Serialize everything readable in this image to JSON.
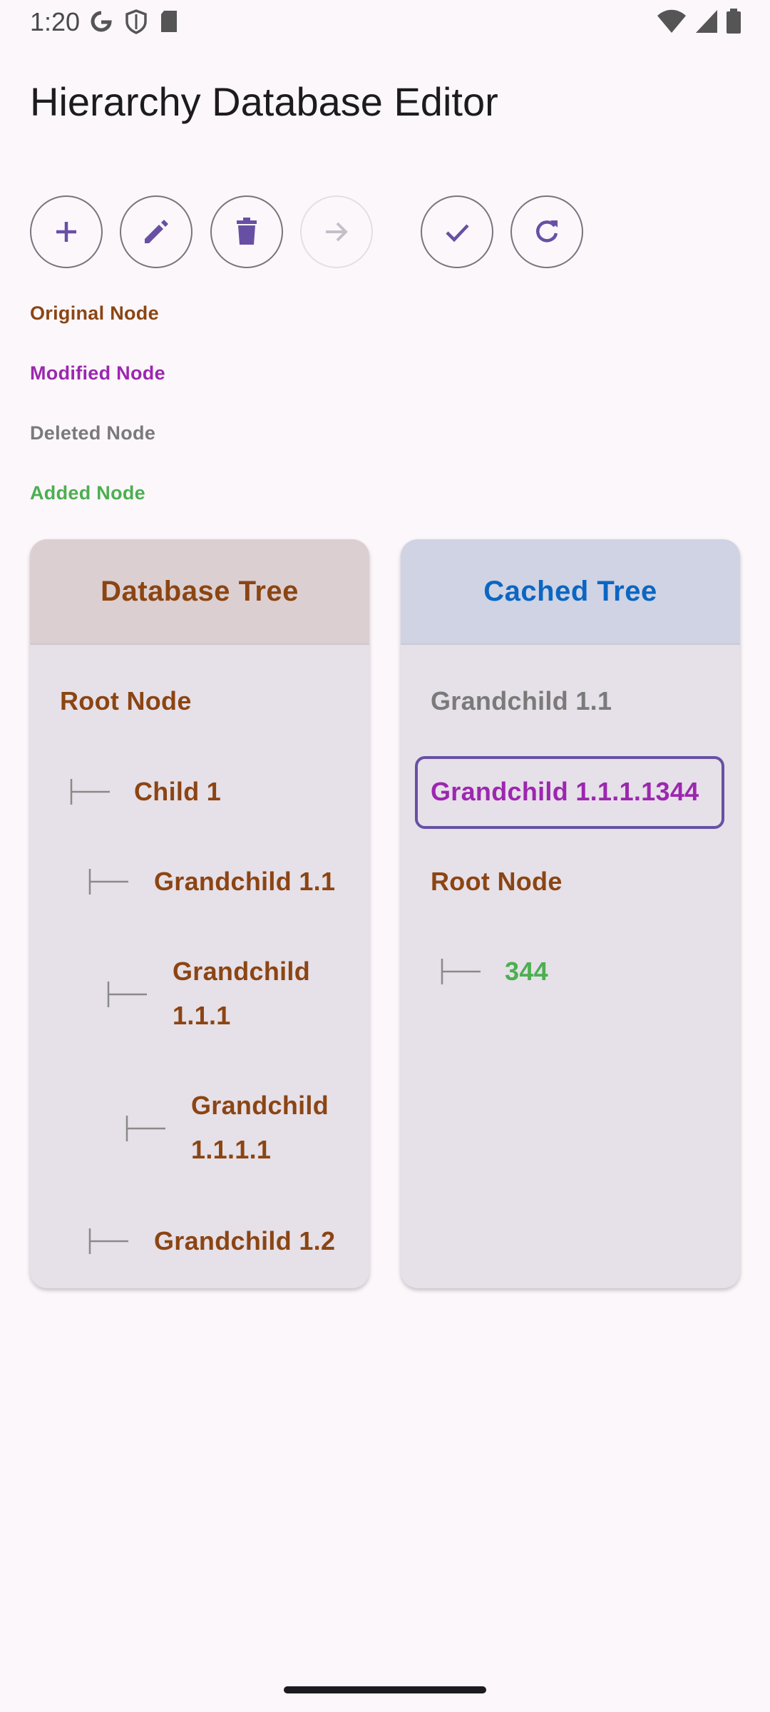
{
  "status": {
    "time": "1:20",
    "icons": [
      "google-icon",
      "shield-icon",
      "sd-card-icon",
      "wifi-icon",
      "signal-icon",
      "battery-icon"
    ]
  },
  "app": {
    "title": "Hierarchy Database Editor"
  },
  "toolbar": {
    "buttons": [
      {
        "icon": "add-icon",
        "enabled": true
      },
      {
        "icon": "edit-icon",
        "enabled": true
      },
      {
        "icon": "delete-icon",
        "enabled": true
      },
      {
        "icon": "arrow-right-icon",
        "enabled": false
      },
      {
        "icon": "check-icon",
        "enabled": true
      },
      {
        "icon": "refresh-icon",
        "enabled": true
      }
    ]
  },
  "legend": {
    "original": "Original Node",
    "modified": "Modified Node",
    "deleted": "Deleted Node",
    "added": "Added Node"
  },
  "colors": {
    "original": "#8b4513",
    "modified": "#9c27b0",
    "deleted": "#7a7a7a",
    "added": "#4caf50",
    "cached_header": "#0b66c3",
    "accent": "#6750a4"
  },
  "database_tree": {
    "title": "Database Tree",
    "nodes": [
      {
        "label": "Root Node",
        "depth": 0
      },
      {
        "label": "Child 1",
        "depth": 1
      },
      {
        "label": "Grandchild 1.1",
        "depth": 2
      },
      {
        "label": "Grandchild 1.1.1",
        "depth": 3
      },
      {
        "label": "Grandchild 1.1.1.1",
        "depth": 4
      },
      {
        "label": "Grandchild 1.2",
        "depth": 2
      }
    ]
  },
  "cached_tree": {
    "title": "Cached Tree",
    "nodes": [
      {
        "label": "Grandchild 1.1",
        "depth": 0,
        "state": "deleted"
      },
      {
        "label": "Grandchild 1.1.1.1344",
        "depth": 0,
        "state": "modified",
        "selected": true
      },
      {
        "label": "Root Node",
        "depth": 0,
        "state": "original"
      },
      {
        "label": "344",
        "depth": 1,
        "state": "added"
      }
    ]
  }
}
